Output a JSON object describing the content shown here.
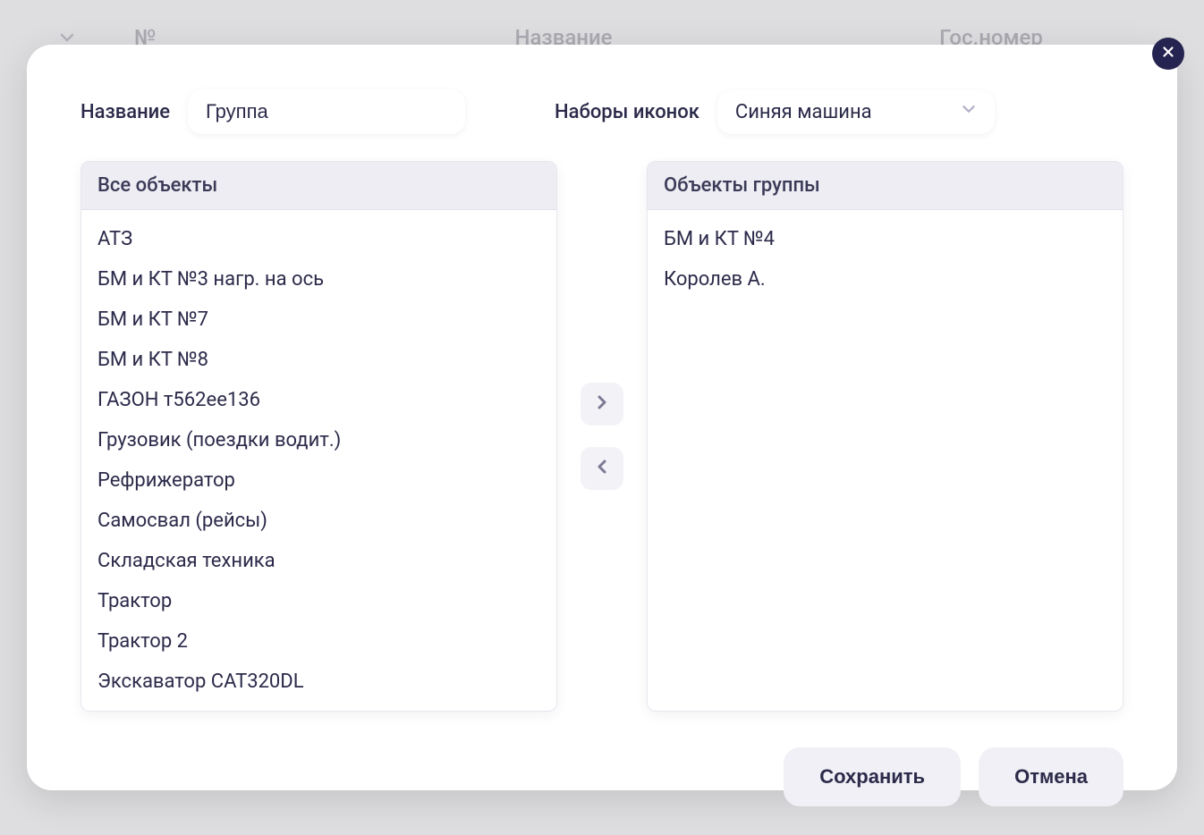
{
  "background": {
    "columns": {
      "number": "№",
      "name": "Название",
      "plate": "Гос.номер"
    }
  },
  "modal": {
    "fields": {
      "name_label": "Название",
      "name_value": "Группа",
      "iconset_label": "Наборы иконок",
      "iconset_value": "Синяя машина"
    },
    "left_header": "Все объекты",
    "right_header": "Объекты группы",
    "all_objects": [
      "АТЗ",
      "БМ и КТ №3 нагр. на ось",
      "БМ и КТ №7",
      "БМ и КТ №8",
      "ГАЗОН т562ее136",
      "Грузовик (поездки водит.)",
      "Рефрижератор",
      "Самосвал (рейсы)",
      "Складская техника",
      "Трактор",
      "Трактор 2",
      "Экскаватор CAT320DL"
    ],
    "group_objects": [
      "БМ и КТ №4",
      "Королев А."
    ],
    "buttons": {
      "save": "Сохранить",
      "cancel": "Отмена"
    }
  }
}
